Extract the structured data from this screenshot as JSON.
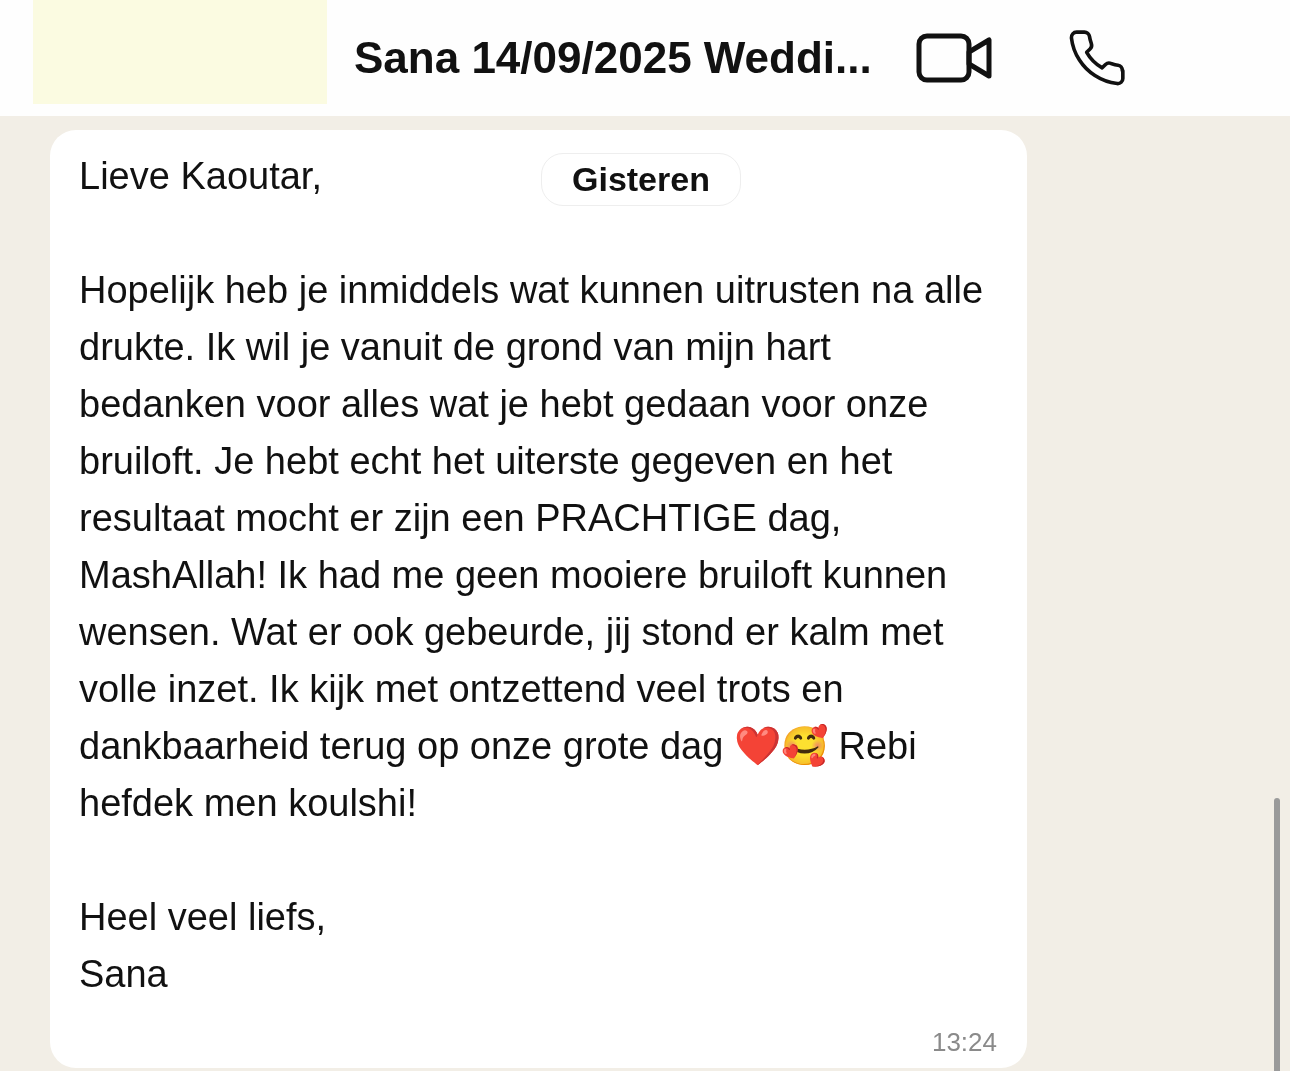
{
  "header": {
    "title": "Sana 14/09/2025 Weddi..."
  },
  "date_divider": "Gisteren",
  "message": {
    "paragraphs": [
      "Lieve Kaoutar,",
      "Hopelijk heb je inmiddels wat kunnen uitrusten na alle drukte. Ik wil je vanuit de grond van mijn hart bedanken voor alles wat je hebt gedaan voor onze bruiloft. Je hebt echt het uiterste gegeven en het resultaat mocht er zijn een PRACHTIGE dag, MashAllah! Ik had me geen mooiere bruiloft kunnen wensen. Wat er ook gebeurde, jij stond er kalm met volle inzet. Ik kijk met ontzettend veel trots en dankbaarheid terug op onze grote dag ❤️🥰 Rebi hefdek men koulshi!",
      "Heel veel liefs,\nSana"
    ],
    "time": "13:24"
  }
}
